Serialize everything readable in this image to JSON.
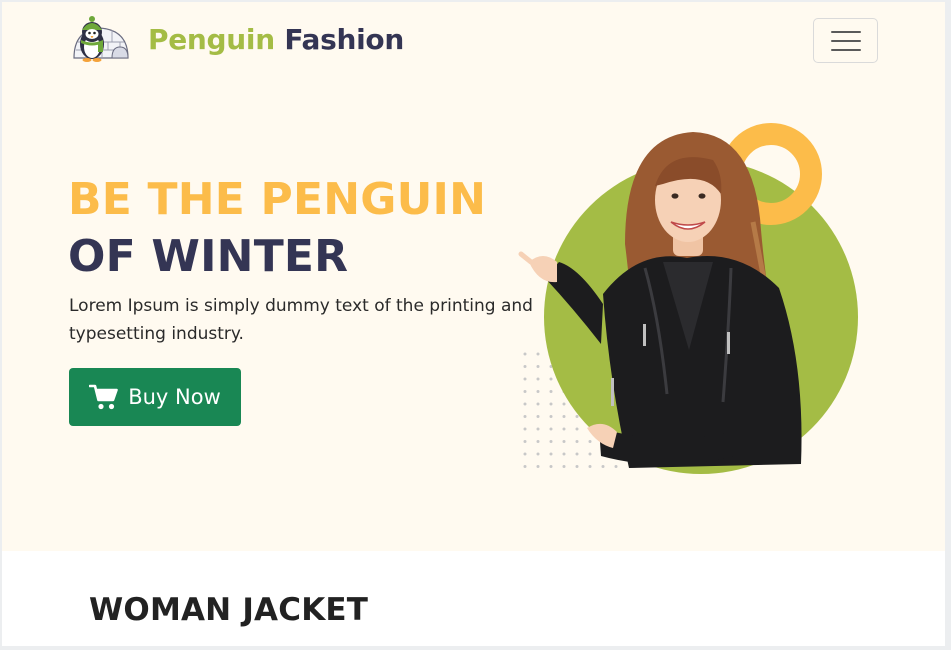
{
  "brand": {
    "name_part1": "Penguin",
    "name_part2": "Fashion"
  },
  "navbar": {
    "toggler_icon": "hamburger-menu-icon"
  },
  "hero": {
    "headline_line1": "BE THE PENGUIN",
    "headline_line2": "OF WINTER",
    "description": "Lorem Ipsum is simply dummy text of the printing and typesetting industry.",
    "cta_label": "Buy Now",
    "cta_icon": "shopping-cart-icon"
  },
  "section": {
    "title": "WOMAN JACKET"
  },
  "colors": {
    "hero_background": "#fffaf0",
    "brand_green": "#a4bc45",
    "brand_navy": "#343554",
    "headline_yellow": "#fcbc4a",
    "cta_green": "#198754",
    "circle_green": "#a4bc45",
    "ring_yellow": "#fcbc4a"
  }
}
